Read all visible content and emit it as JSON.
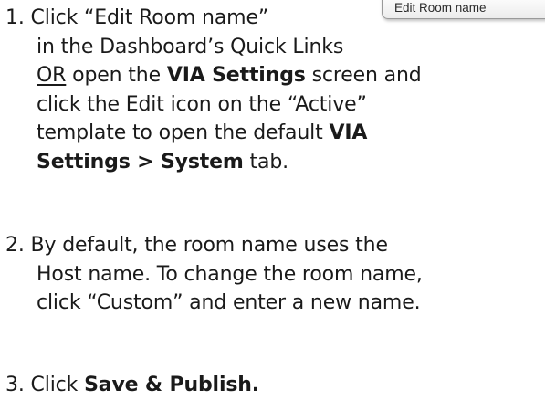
{
  "thumbnail": {
    "button_label": "Edit Room name"
  },
  "steps": [
    {
      "number": "1.",
      "lines": [
        [
          "Click “Edit Room name”"
        ],
        [
          "in the Dashboard’s Quick Links"
        ],
        [
          "OR",
          " open the ",
          "VIA Settings",
          " screen and"
        ],
        [
          "click the Edit icon on the “Active”"
        ],
        [
          "template to open the default ",
          "VIA"
        ],
        [
          "Settings > System",
          " tab."
        ]
      ]
    },
    {
      "number": "2.",
      "lines": [
        [
          "By default, the room name uses the"
        ],
        [
          "Host name. To change the room name,"
        ],
        [
          "click “Custom” and enter a new name."
        ]
      ]
    },
    {
      "number": "3.",
      "lines": [
        [
          "Click ",
          "Save & Publish."
        ]
      ]
    }
  ]
}
